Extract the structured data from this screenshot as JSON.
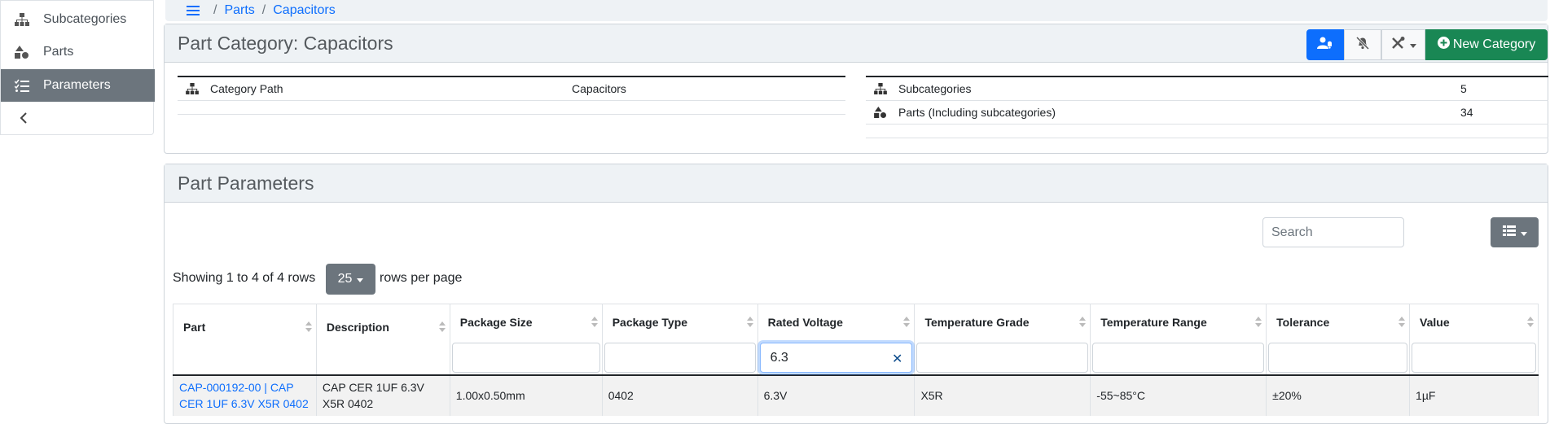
{
  "sidebar": {
    "items": [
      {
        "label": "Subcategories",
        "icon": "sitemap-icon"
      },
      {
        "label": "Parts",
        "icon": "shapes-icon"
      },
      {
        "label": "Parameters",
        "icon": "tasks-icon",
        "active": true
      }
    ],
    "collapse_icon": "chevron-left-icon"
  },
  "breadcrumb": {
    "items": [
      "Parts",
      "Capacitors"
    ],
    "separator": "/"
  },
  "category": {
    "title": "Part Category: Capacitors",
    "new_button_label": "New Category",
    "path_label": "Category Path",
    "path_value": "Capacitors",
    "stats": [
      {
        "label": "Subcategories",
        "value": "5"
      },
      {
        "label": "Parts (Including subcategories)",
        "value": "34"
      }
    ]
  },
  "parameters": {
    "title": "Part Parameters",
    "search_placeholder": "Search",
    "showing_text": "Showing 1 to 4 of 4 rows",
    "rows_per_page": "25",
    "rows_per_page_label": "rows per page",
    "columns": [
      "Part",
      "Description",
      "Package Size",
      "Package Type",
      "Rated Voltage",
      "Temperature Grade",
      "Temperature Range",
      "Tolerance",
      "Value"
    ],
    "filters": [
      "",
      "",
      "",
      "",
      "6.3",
      "",
      "",
      "",
      ""
    ],
    "rows": [
      {
        "part": "CAP-000192-00 | CAP CER 1UF 6.3V X5R 0402",
        "description": "CAP CER 1UF 6.3V X5R 0402",
        "package_size": "1.00x0.50mm",
        "package_type": "0402",
        "rated_voltage": "6.3V",
        "temperature_grade": "X5R",
        "temperature_range": "-55~85°C",
        "tolerance": "±20%",
        "value": "1µF"
      }
    ]
  },
  "colors": {
    "primary": "#0d6efd",
    "success": "#198754",
    "secondary": "#6c757d",
    "header_bg": "#eef2f5"
  }
}
